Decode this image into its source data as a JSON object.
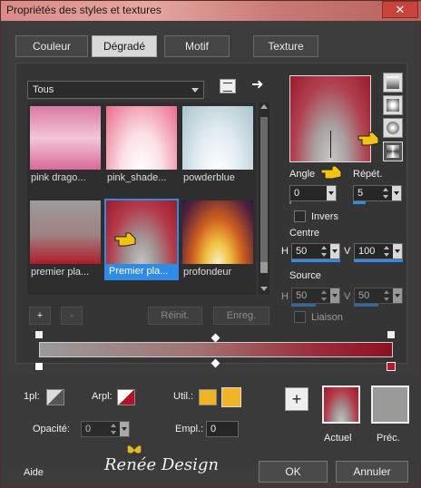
{
  "window": {
    "title": "Propriétés des styles et textures",
    "close_label": "✕"
  },
  "tabs": [
    {
      "label": "Couleur",
      "active": false
    },
    {
      "label": "Dégradé",
      "active": true
    },
    {
      "label": "Motif",
      "active": false
    },
    {
      "label": "Texture",
      "active": false
    }
  ],
  "filter": {
    "selected": "Tous"
  },
  "thumbnails": [
    {
      "label": "pink drago...",
      "selected": false
    },
    {
      "label": "pink_shade...",
      "selected": false
    },
    {
      "label": "powderblue",
      "selected": false
    },
    {
      "label": "premier pla...",
      "selected": false
    },
    {
      "label": "Premier pla...",
      "selected": true
    },
    {
      "label": "profondeur",
      "selected": false
    }
  ],
  "gradient_controls": {
    "angle_label": "Angle",
    "angle_value": "0",
    "repeat_label": "Répét.",
    "repeat_value": "5",
    "invert_label": "Invers",
    "center_label": "Centre",
    "center_h_label": "H",
    "center_h_value": "50",
    "center_v_label": "V",
    "center_v_value": "100",
    "source_label": "Source",
    "source_h_label": "H",
    "source_h_value": "50",
    "source_v_label": "V",
    "source_v_value": "50",
    "link_label": "Liaison"
  },
  "editor_buttons": {
    "add": "+",
    "remove": "-",
    "reset": "Réinit.",
    "save": "Enreg."
  },
  "stop_controls": {
    "one_pl_label": "1pl:",
    "arpl_label": "Arpl:",
    "util_label": "Util.:",
    "opacity_label": "Opacité:",
    "opacity_value": "0",
    "empl_label": "Empl.:",
    "empl_value": "0"
  },
  "swatches": {
    "add_label": "+",
    "current_label": "Actuel",
    "previous_label": "Préc."
  },
  "footer": {
    "help_label": "Aide",
    "watermark": "Renée Design",
    "ok_label": "OK",
    "cancel_label": "Annuler"
  },
  "colors": {
    "accent": "#2e8be6",
    "gradient_start": "#9a9a9a",
    "gradient_end": "#8c1222",
    "util_swatch": "#f0b428"
  }
}
